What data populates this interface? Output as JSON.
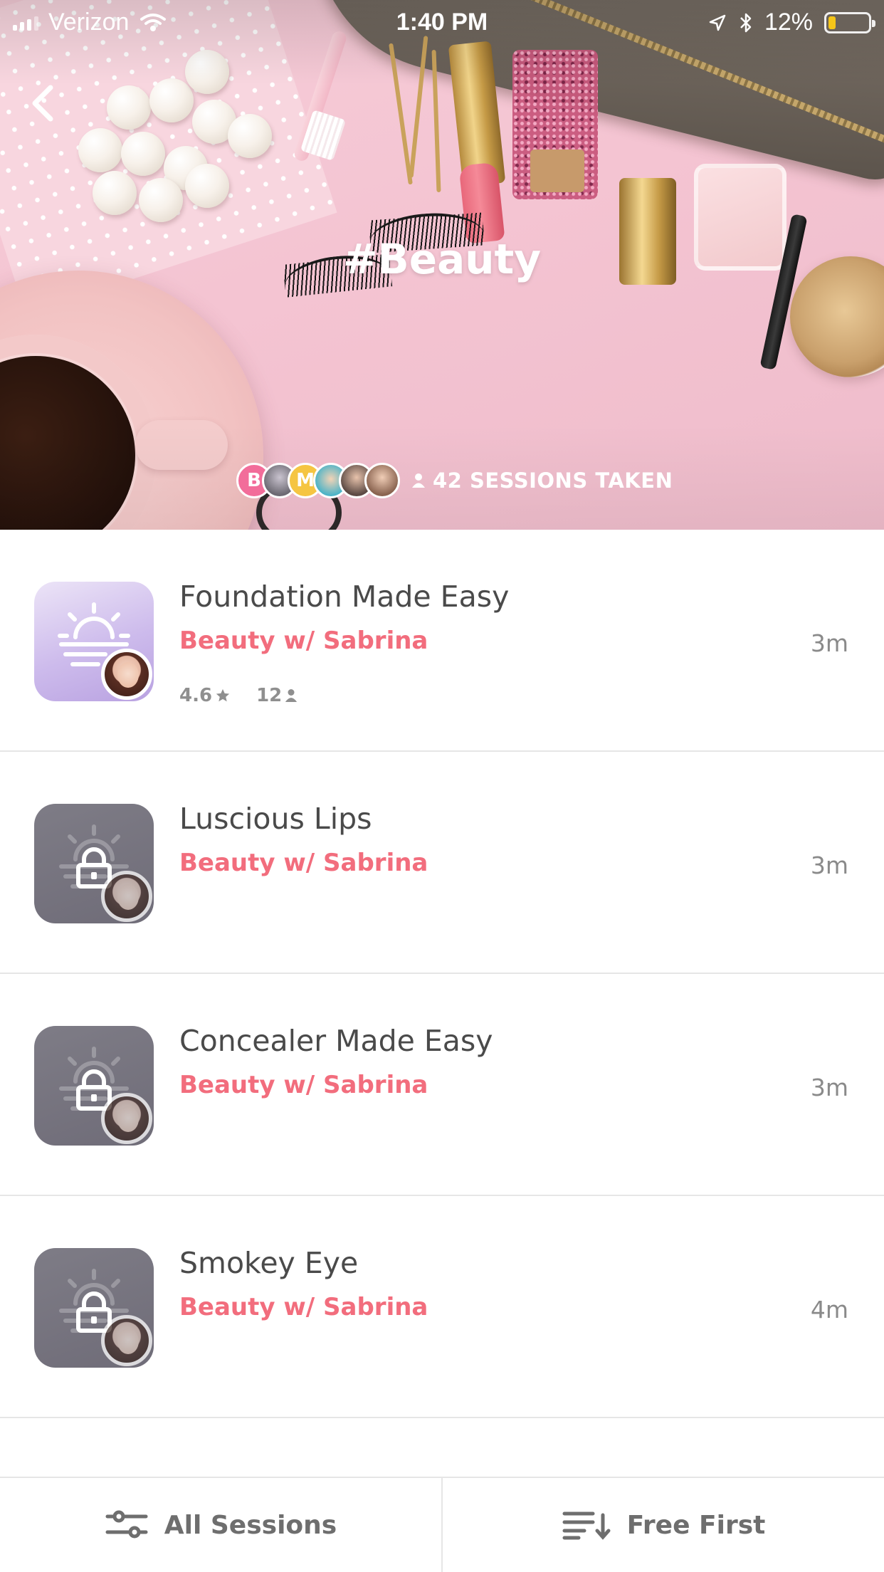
{
  "status_bar": {
    "carrier": "Verizon",
    "time": "1:40 PM",
    "battery": "12%"
  },
  "hero": {
    "title": "#Beauty",
    "sessions_taken": "42 SESSIONS TAKEN",
    "avatars": [
      {
        "letter": "B",
        "color": "#f26d9a"
      },
      {
        "letter": "",
        "color": "#6d6a73"
      },
      {
        "letter": "M",
        "color": "#f5c542"
      },
      {
        "letter": "",
        "color": "#4bb3c7"
      },
      {
        "letter": "",
        "color": "#5c4a44"
      },
      {
        "letter": "",
        "color": "#8a6450"
      }
    ]
  },
  "sessions": [
    {
      "title": "Foundation Made Easy",
      "subtitle": "Beauty w/ Sabrina",
      "duration": "3m",
      "rating": "4.6",
      "count": "12",
      "locked": false
    },
    {
      "title": "Luscious Lips",
      "subtitle": "Beauty w/ Sabrina",
      "duration": "3m",
      "locked": true
    },
    {
      "title": "Concealer Made Easy",
      "subtitle": "Beauty w/ Sabrina",
      "duration": "3m",
      "locked": true
    },
    {
      "title": "Smokey Eye",
      "subtitle": "Beauty w/ Sabrina",
      "duration": "4m",
      "locked": true
    }
  ],
  "bottom_bar": {
    "all_sessions": "All Sessions",
    "free_first": "Free First"
  },
  "colors": {
    "accent": "#f26d7d",
    "battery_fill": "#f5c518",
    "thumb_unlocked": "#cdbbec",
    "thumb_locked": "#74717d"
  }
}
